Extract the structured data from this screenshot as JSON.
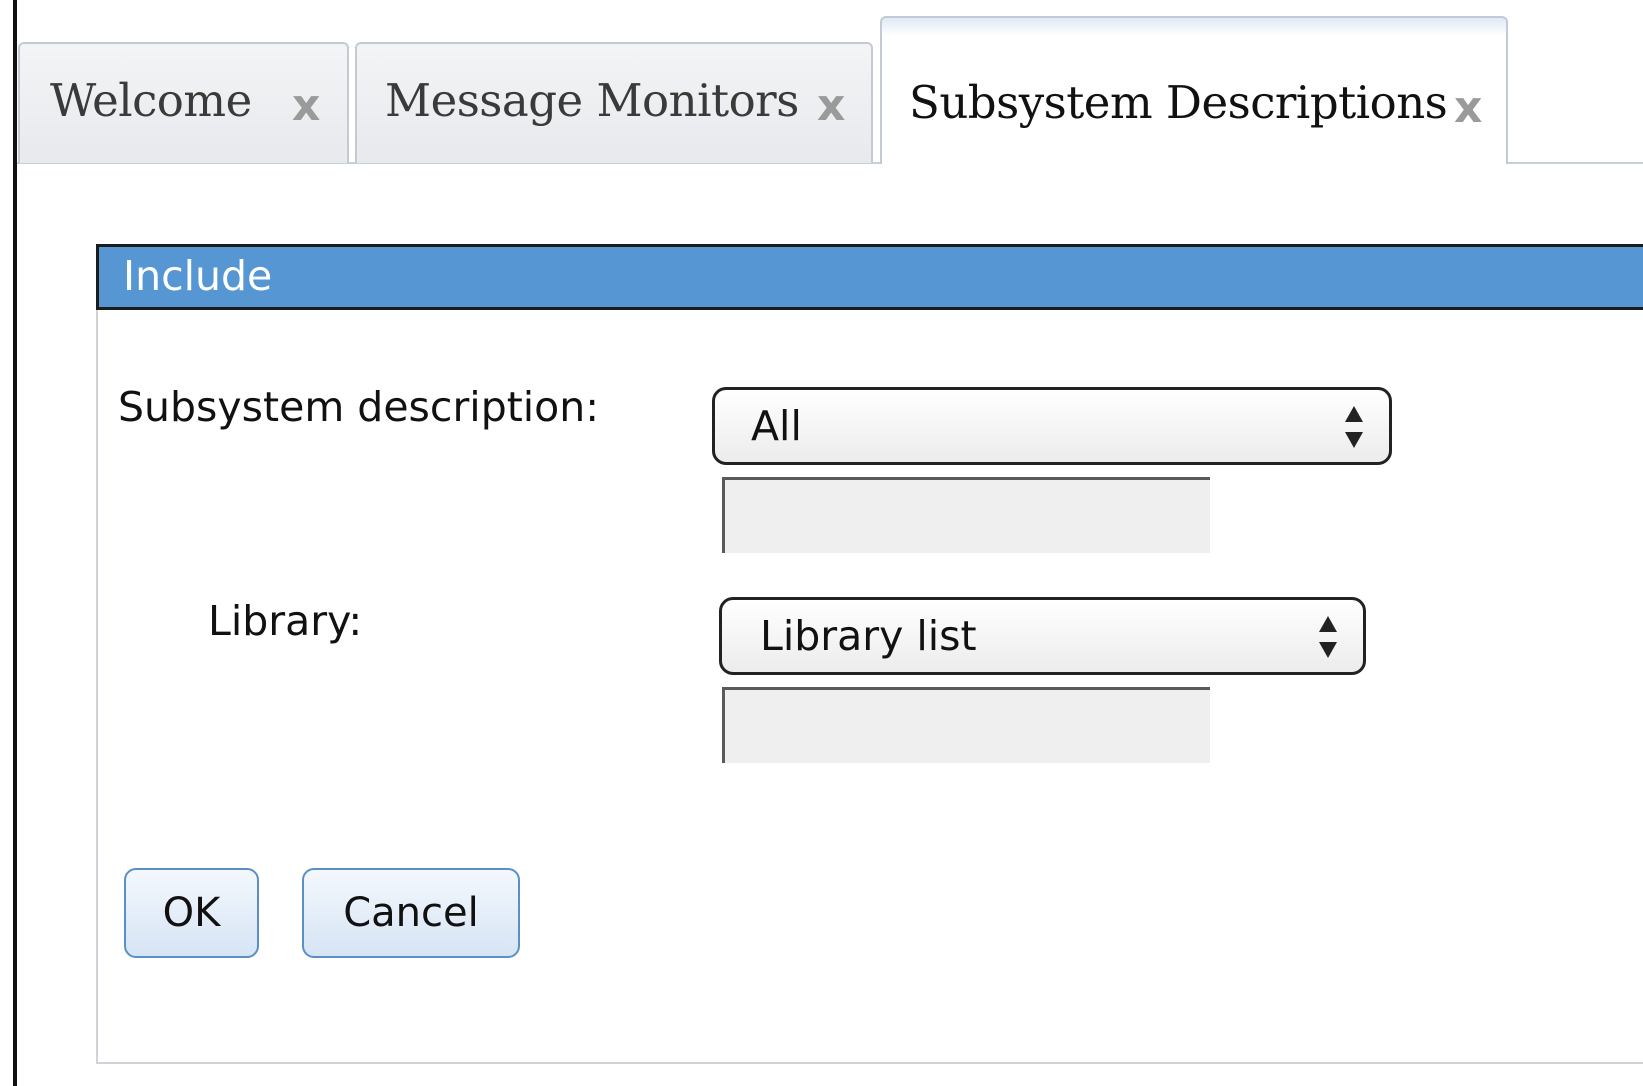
{
  "tabs": [
    {
      "label": "Welcome",
      "close_glyph": "x",
      "active": false
    },
    {
      "label": "Message Monitors",
      "close_glyph": "x",
      "active": false
    },
    {
      "label": "Subsystem Descriptions",
      "close_glyph": "x",
      "active": true
    }
  ],
  "dialog": {
    "title": "Include",
    "subsystem": {
      "label": "Subsystem description:",
      "selected": "All",
      "input_value": ""
    },
    "library": {
      "label": "Library:",
      "selected": "Library list",
      "input_value": ""
    },
    "buttons": {
      "ok": "OK",
      "cancel": "Cancel"
    }
  },
  "colors": {
    "title_bar": "#5596d3",
    "button_border": "#5b8fc7"
  },
  "icons": {
    "tab_close": "close-icon",
    "select_arrows": "updown-arrows-icon"
  }
}
